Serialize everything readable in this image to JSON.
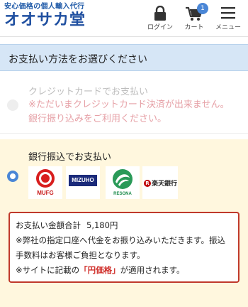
{
  "header": {
    "tagline": "安心価格の個人輸入代行",
    "logo": "オオサカ堂",
    "nav": {
      "login_label": "ログイン",
      "cart_label": "カート",
      "cart_count": "1",
      "menu_label": "メニュー"
    }
  },
  "section": {
    "title": "お支払い方法をお選びください"
  },
  "payment_options": {
    "card": {
      "title": "クレジットカードでお支払い",
      "warning_line1": "※ただいまクレジットカード決済が出来ません。",
      "warning_line2": "銀行振り込みをご利用ください。"
    },
    "bank": {
      "title": "銀行振込でお支払い",
      "banks": {
        "mufg": "MUFG",
        "mizuho": "MIZUHO",
        "resona": "RESONA",
        "rakuten": "楽天銀行"
      },
      "notice": {
        "total_label": "お支払い金額合計",
        "total_amount": "5,180円",
        "line2": "※弊社の指定口座へ代金をお振り込みいただきます。振込手数料はお客様ご負担となります。",
        "line3_prefix": "※サイトに記載の",
        "line3_highlight": "「円価格」",
        "line3_suffix": "が適用されます。"
      }
    }
  },
  "colors": {
    "brand": "#1f4fa0",
    "accent": "#4a86d6",
    "section_bg": "#d6e6f6",
    "selected_bg": "#fff7de",
    "warning": "#d0312d"
  }
}
